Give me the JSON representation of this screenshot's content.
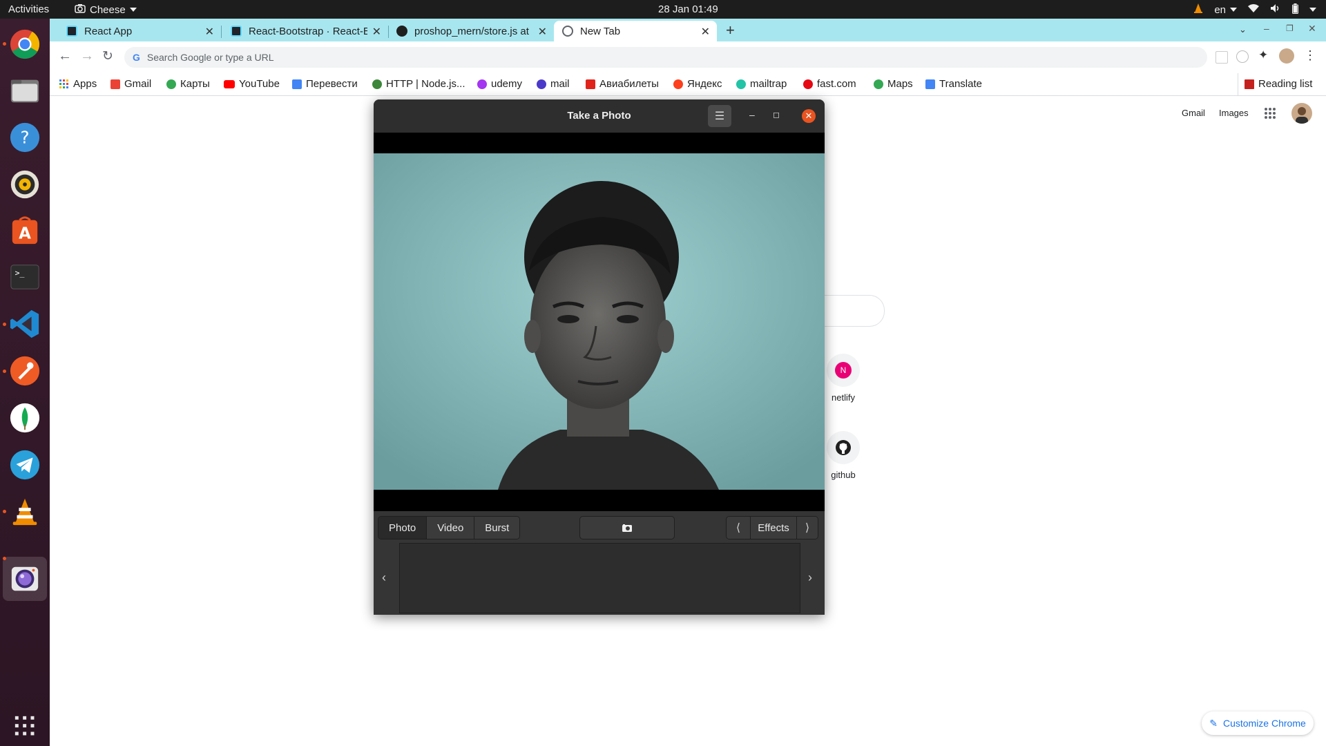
{
  "topbar": {
    "activities": "Activities",
    "app_name": "Cheese",
    "clock": "28 Jan  01:49",
    "keyboard_layout": "en"
  },
  "dock": {
    "items": [
      "chrome-icon",
      "files-icon",
      "help-icon",
      "rhythmbox-icon",
      "app-center-icon",
      "terminal-icon",
      "vscode-icon",
      "postman-icon",
      "mongodb-compass-icon",
      "telegram-icon",
      "vlc-icon",
      "cheese-icon"
    ]
  },
  "tabs": [
    {
      "title": "React App",
      "active": false
    },
    {
      "title": "React-Bootstrap · React-B",
      "active": false
    },
    {
      "title": "proshop_mern/store.js at",
      "active": false
    },
    {
      "title": "New Tab",
      "active": true
    }
  ],
  "omnibox": {
    "placeholder": "Search Google or type a URL"
  },
  "bookmarks": [
    {
      "label": "Apps",
      "icon": "apps-grid-icon",
      "color": "#4285f4"
    },
    {
      "label": "Gmail",
      "icon": "gmail-icon",
      "color": "#ea4335"
    },
    {
      "label": "Карты",
      "icon": "maps-icon",
      "color": "#34a853"
    },
    {
      "label": "YouTube",
      "icon": "youtube-icon",
      "color": "#ff0000"
    },
    {
      "label": "Перевести",
      "icon": "translate-icon",
      "color": "#4285f4"
    },
    {
      "label": "HTTP | Node.js...",
      "icon": "nodejs-icon",
      "color": "#3c873a"
    },
    {
      "label": "udemy",
      "icon": "udemy-icon",
      "color": "#a435f0"
    },
    {
      "label": "mail",
      "icon": "mail-icon",
      "color": "#4b3ac9"
    },
    {
      "label": "Авиабилеты",
      "icon": "aviasales-icon",
      "color": "#e0241b"
    },
    {
      "label": "Яндекс",
      "icon": "yandex-icon",
      "color": "#fc3f1d"
    },
    {
      "label": "mailtrap",
      "icon": "mailtrap-icon",
      "color": "#22c3a6"
    },
    {
      "label": "fast.com",
      "icon": "fastcom-icon",
      "color": "#e50914"
    },
    {
      "label": "Maps",
      "icon": "maps-icon",
      "color": "#34a853"
    },
    {
      "label": "Translate",
      "icon": "translate-icon",
      "color": "#4285f4"
    }
  ],
  "reading_list": "Reading list",
  "ntp": {
    "gmail": "Gmail",
    "images": "Images",
    "shortcuts": [
      {
        "label": "netlify",
        "letter": "N",
        "color": "#ea0075"
      },
      {
        "label": "github",
        "icon": "github-icon"
      }
    ],
    "customize": "Customize Chrome"
  },
  "cheese": {
    "title": "Take a Photo",
    "modes": [
      "Photo",
      "Video",
      "Burst"
    ],
    "selected_mode": "Photo",
    "effects": "Effects",
    "accent": "#e95420"
  }
}
